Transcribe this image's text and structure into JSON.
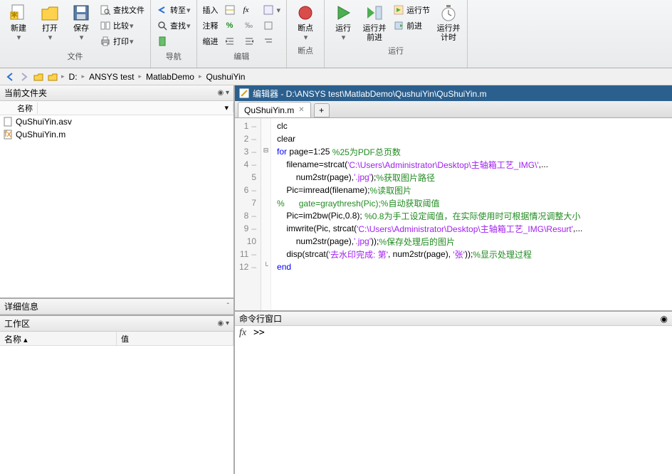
{
  "ribbon": {
    "groups": {
      "file": {
        "label": "文件",
        "new": "新建",
        "open": "打开",
        "save": "保存",
        "find_files": "查找文件",
        "compare": "比较",
        "print": "打印"
      },
      "nav": {
        "label": "导航",
        "goto": "转至",
        "find": "查找"
      },
      "edit": {
        "label": "编辑",
        "insert": "插入",
        "comment": "注释",
        "indent": "缩进",
        "fx": "fx"
      },
      "bp": {
        "label": "断点",
        "breakpoints": "断点"
      },
      "run": {
        "label": "运行",
        "run": "运行",
        "run_advance": "运行并\n前进",
        "run_section": "运行节",
        "advance": "前进",
        "run_time": "运行并\n计时"
      }
    }
  },
  "path": {
    "drive": "D:",
    "p1": "ANSYS test",
    "p2": "MatlabDemo",
    "p3": "QushuiYin"
  },
  "current_folder": {
    "title": "当前文件夹",
    "col_name": "名称",
    "files": [
      {
        "name": "QuShuiYin.asv"
      },
      {
        "name": "QuShuiYin.m"
      }
    ]
  },
  "details": {
    "title": "详细信息"
  },
  "workspace": {
    "title": "工作区",
    "col_name": "名称",
    "col_value": "值"
  },
  "editor": {
    "title": "编辑器 - D:\\ANSYS test\\MatlabDemo\\QushuiYin\\QuShuiYin.m",
    "tab": "QuShuiYin.m"
  },
  "cmd": {
    "title": "命令行窗口",
    "prompt": ">>"
  },
  "code": {
    "l1": {
      "a": "clc"
    },
    "l2": {
      "a": "clear"
    },
    "l3": {
      "a": "for",
      "b": " page=1:25 ",
      "c": "%25为PDF总页数"
    },
    "l4": {
      "a": "    filename=strcat(",
      "b": "'C:\\Users\\Administrator\\Desktop\\主轴箱工艺_IMG\\'",
      "c": ",..."
    },
    "l5": {
      "a": "        num2str(page),",
      "b": "'.jpg'",
      "c": ");",
      "d": "%获取图片路径"
    },
    "l6": {
      "a": "    Pic=imread(filename);",
      "b": "%读取图片"
    },
    "l7": {
      "a": "%      gate=graythresh(Pic);%自动获取阈值"
    },
    "l8": {
      "a": "    Pic=im2bw(Pic,0.8); ",
      "b": "%0.8为手工设定阈值，在实际使用时可根据情况调整大小"
    },
    "l9": {
      "a": "    imwrite(Pic, strcat(",
      "b": "'C:\\Users\\Administrator\\Desktop\\主轴箱工艺_IMG\\Resurt'",
      "c": ",..."
    },
    "l10": {
      "a": "        num2str(page),",
      "b": "'.jpg'",
      "c": "));",
      "d": "%保存处理后的图片"
    },
    "l11": {
      "a": "    disp(strcat(",
      "b": "'去水印完成: 第'",
      "c": ", num2str(page), ",
      "d": "'张'",
      "e": "));",
      "f": "%显示处理过程"
    },
    "l12": {
      "a": "end"
    }
  }
}
